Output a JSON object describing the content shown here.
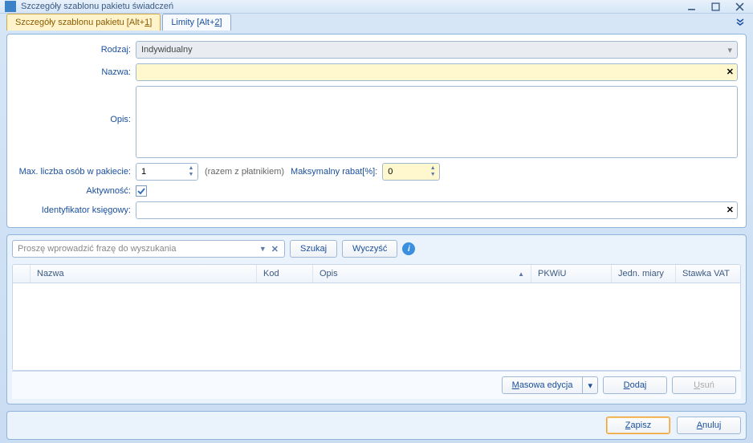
{
  "window": {
    "title": "Szczegóły szablonu pakietu świadczeń"
  },
  "tabs": {
    "active": "Szczegóły szablonu pakietu [Alt+1]",
    "other": "Limity [Alt+2]"
  },
  "form": {
    "rodzaj_label": "Rodzaj:",
    "rodzaj_value": "Indywidualny",
    "nazwa_label": "Nazwa:",
    "nazwa_value": "",
    "opis_label": "Opis:",
    "opis_value": "",
    "max_label": "Max. liczba osób w pakiecie:",
    "max_value": "1",
    "max_hint": "(razem z płatnikiem)",
    "rabat_label": "Maksymalny rabat[%]:",
    "rabat_value": "0",
    "akt_label": "Aktywność:",
    "akt_checked": true,
    "id_label": "Identyfikator księgowy:",
    "id_value": ""
  },
  "search": {
    "placeholder": "Proszę wprowadzić frazę do wyszukania",
    "szukaj": "Szukaj",
    "wyczysc": "Wyczyść"
  },
  "grid": {
    "cols": {
      "nazwa": "Nazwa",
      "kod": "Kod",
      "opis": "Opis",
      "pkwiu": "PKWiU",
      "jedn": "Jedn. miary",
      "vat": "Stawka VAT"
    }
  },
  "grid_buttons": {
    "masowa": "Masowa edycja",
    "dodaj": "Dodaj",
    "usun": "Usuń"
  },
  "bottom": {
    "zapisz": "Zapisz",
    "anuluj": "Anuluj"
  }
}
